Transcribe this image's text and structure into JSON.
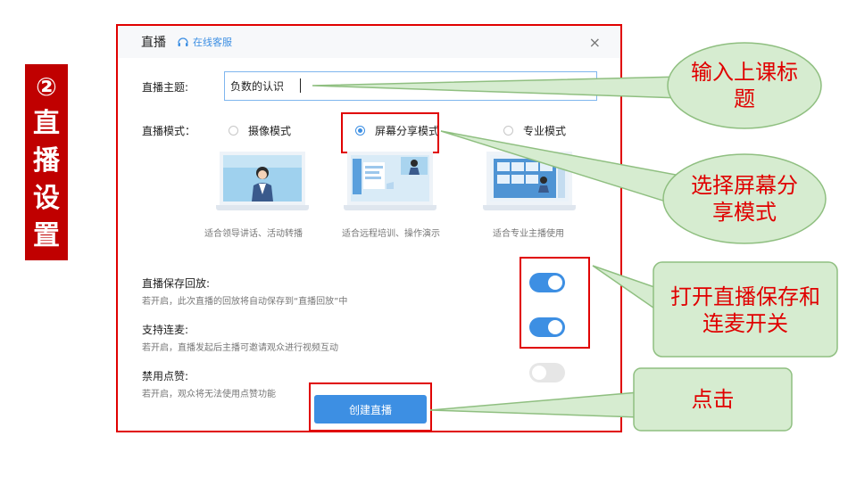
{
  "step": {
    "number": "②",
    "chars": [
      "直",
      "播",
      "设",
      "置"
    ]
  },
  "dialog": {
    "title": "直播",
    "support_label": "在线客服",
    "close": "×",
    "topic_label": "直播主题:",
    "topic_value": "负数的认识",
    "mode_label": "直播模式：",
    "modes": [
      {
        "label": "摄像模式",
        "desc": "适合领导讲话、活动转播",
        "selected": false
      },
      {
        "label": "屏幕分享模式",
        "desc": "适合远程培训、操作演示",
        "selected": true
      },
      {
        "label": "专业模式",
        "desc": "适合专业主播使用",
        "selected": false
      }
    ],
    "options": [
      {
        "title": "直播保存回放:",
        "desc": "若开启，此次直播的回放将自动保存到“直播回放”中",
        "enabled": true
      },
      {
        "title": "支持连麦:",
        "desc": "若开启，直播发起后主播可邀请观众进行视频互动",
        "enabled": true
      },
      {
        "title": "禁用点赞:",
        "desc": "若开启，观众将无法使用点赞功能",
        "enabled": false
      }
    ],
    "create_button": "创建直播"
  },
  "callouts": [
    {
      "text": "输入上课标题"
    },
    {
      "text": "选择屏幕分享模式"
    },
    {
      "text": "打开直播保存和连麦开关"
    },
    {
      "text": "点击"
    }
  ],
  "colors": {
    "accent": "#3d8fe3",
    "highlight": "#e00000",
    "callout_fill": "#d6ecd0",
    "callout_stroke": "#8fbf80"
  }
}
